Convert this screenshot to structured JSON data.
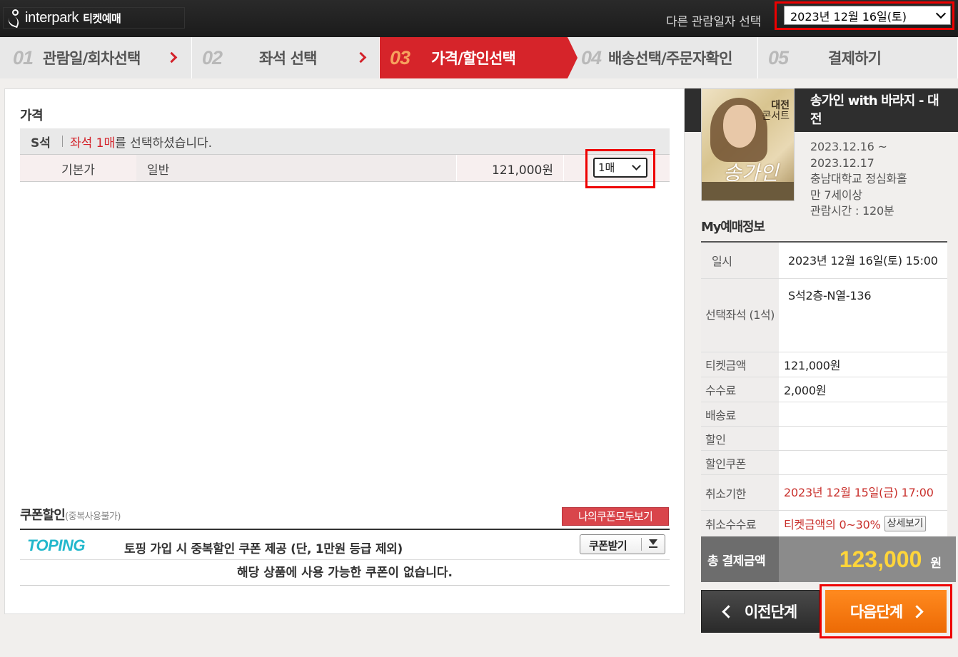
{
  "header": {
    "logo_text": "interpark",
    "logo_sub": "티켓예매",
    "date_label": "다른 관람일자 선택",
    "date_selected": "2023년 12월 16일(토)"
  },
  "steps": [
    {
      "num": "01",
      "label": "관람일/회차선택"
    },
    {
      "num": "02",
      "label": "좌석 선택"
    },
    {
      "num": "03",
      "label": "가격/할인선택"
    },
    {
      "num": "04",
      "label": "배송선택/주문자확인"
    },
    {
      "num": "05",
      "label": "결제하기"
    }
  ],
  "price": {
    "title": "가격",
    "seat_grade": "S석",
    "seat_msg_prefix": "좌석 1매",
    "seat_msg_suffix": "를 선택하셨습니다.",
    "row": {
      "type": "기본가",
      "name": "일반",
      "amount": "121,000원",
      "qty": "1매"
    }
  },
  "coupon": {
    "title": "쿠폰할인",
    "subtitle": "(중복사용불가)",
    "my_coupons_button": "나의쿠폰모두보기",
    "toping_logo": "TOPING",
    "toping_msg": "토핑 가입 시 중복할인 쿠폰 제공 (단, 1만원 등급 제외)",
    "get_button": "쿠폰받기",
    "empty_msg": "해당 상품에 사용 가능한 쿠폰이 없습니다."
  },
  "show": {
    "poster_line1": "대전",
    "poster_line2": "콘서트",
    "poster_script": "송가인",
    "title": "송가인 with 바라지 - 대전",
    "period_start": "2023.12.16 ~",
    "period_end": "2023.12.17",
    "venue": "충남대학교 정심화홀",
    "age": "만 7세이상",
    "runtime": "관람시간 : 120분"
  },
  "my_booking": {
    "title": "My예매정보",
    "rows": [
      {
        "k": "일시",
        "v": "2023년 12월 16일(토) 15:00"
      },
      {
        "k": "선택좌석 (1석)",
        "v": "S석2층-N열-136"
      },
      {
        "k": "티켓금액",
        "v": "121,000원"
      },
      {
        "k": "수수료",
        "v": "2,000원"
      },
      {
        "k": "배송료",
        "v": ""
      },
      {
        "k": "할인",
        "v": ""
      },
      {
        "k": "할인쿠폰",
        "v": ""
      },
      {
        "k": "취소기한",
        "v": "2023년 12월 15일(금) 17:00"
      },
      {
        "k": "취소수수료",
        "v": "티켓금액의 0~30%"
      }
    ],
    "detail_button": "상세보기",
    "total_label": "총 결제금액",
    "total_value": "123,000",
    "total_unit": "원"
  },
  "buttons": {
    "prev": "이전단계",
    "next": "다음단계"
  }
}
